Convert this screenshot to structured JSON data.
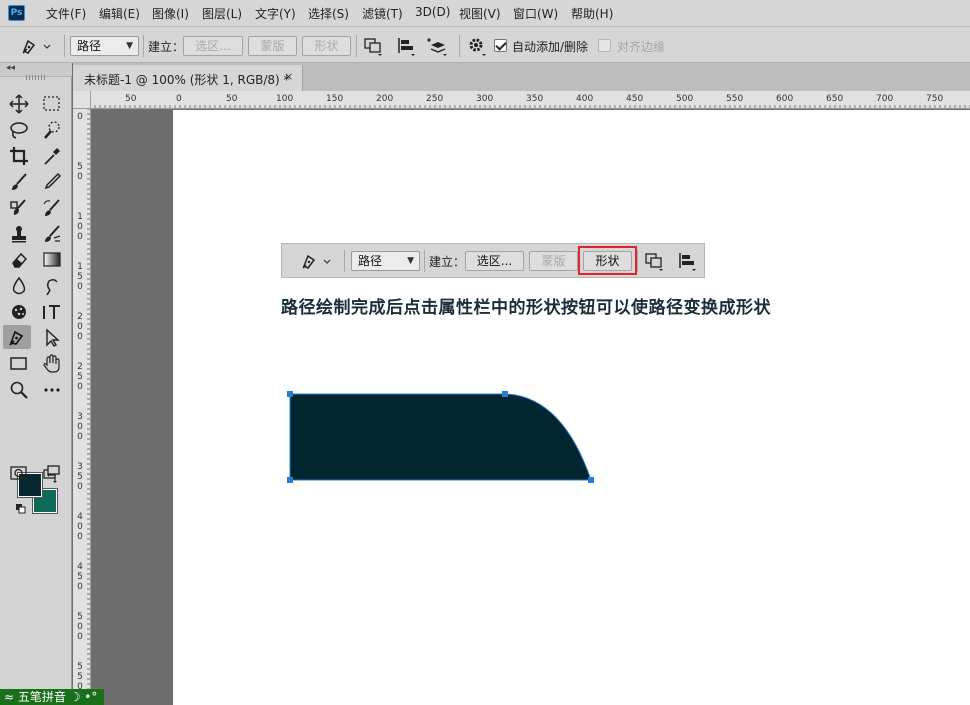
{
  "app": {
    "logo": "Ps"
  },
  "menu": [
    "文件(F)",
    "编辑(E)",
    "图像(I)",
    "图层(L)",
    "文字(Y)",
    "选择(S)",
    "滤镜(T)",
    "3D(D)",
    "视图(V)",
    "窗口(W)",
    "帮助(H)"
  ],
  "options": {
    "mode_value": "路径",
    "make_label": "建立：",
    "selection_btn": "选区...",
    "mask_btn": "蒙版",
    "shape_btn": "形状",
    "auto_add_delete": "自动添加/删除",
    "align_edges": "对齐边缘"
  },
  "document_tab": {
    "title": "未标题-1 @ 100% (形状 1, RGB/8) *",
    "close": "×"
  },
  "ruler_h": [
    "50",
    "0",
    "50",
    "100",
    "150",
    "200",
    "250",
    "300",
    "350",
    "400",
    "450",
    "500",
    "550",
    "600",
    "650",
    "700",
    "750"
  ],
  "ruler_v": [
    "0",
    "50",
    "100",
    "150",
    "200",
    "250",
    "300",
    "350",
    "400",
    "450",
    "500",
    "550"
  ],
  "demo_bar": {
    "mode_value": "路径",
    "make_label": "建立：",
    "selection_btn": "选区...",
    "mask_btn": "蒙版",
    "shape_btn": "形状"
  },
  "caption": "路径绘制完成后点击属性栏中的形状按钮可以使路径变换成形状",
  "colors": {
    "foreground": "#07262f",
    "background": "#0e6b57",
    "shape_fill": "#022630",
    "anchor": "#2a7bd4",
    "highlight": "#e0262a"
  },
  "ime": {
    "label": "五笔拼音"
  },
  "icons": {
    "toolbar": [
      "move-icon",
      "marquee-icon",
      "lasso-icon",
      "quick-select-icon",
      "crop-icon",
      "eyedropper-icon",
      "healing-brush-icon",
      "brush-icon",
      "clone-stamp-icon",
      "history-brush-icon",
      "eraser-icon",
      "gradient-icon",
      "blur-icon",
      "dodge-icon",
      "sponge-icon",
      "type-icon",
      "pen-icon",
      "path-select-icon",
      "rectangle-icon",
      "hand-icon",
      "zoom-icon",
      "more-icon",
      "quick-mask-icon",
      "screen-mode-icon"
    ]
  }
}
